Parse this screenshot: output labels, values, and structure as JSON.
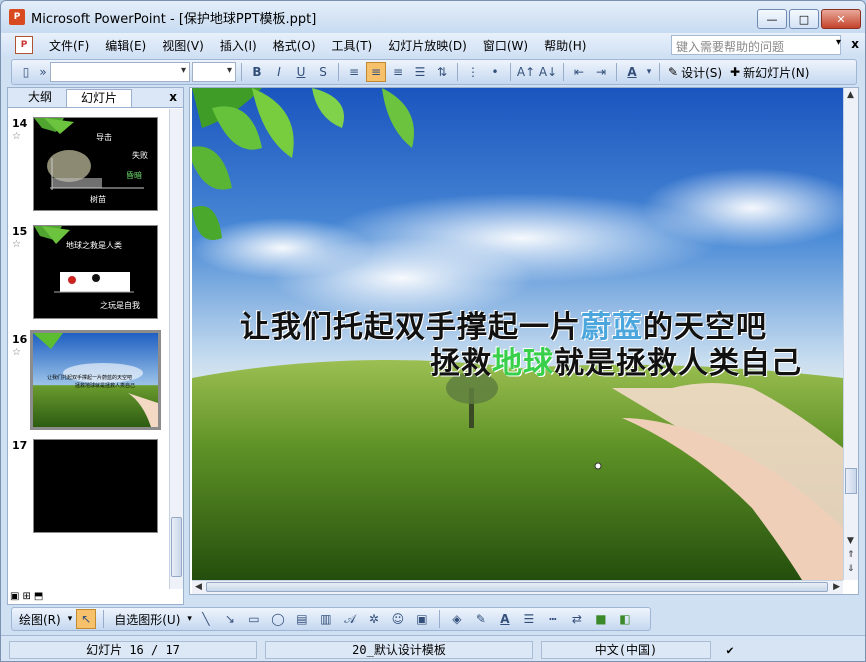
{
  "window": {
    "title": "Microsoft PowerPoint - [保护地球PPT模板.ppt]",
    "app_icon_letters": "P",
    "minimize": "—",
    "maximize": "□",
    "close": "✕"
  },
  "menu": {
    "items": [
      "文件(F)",
      "编辑(E)",
      "视图(V)",
      "插入(I)",
      "格式(O)",
      "工具(T)",
      "幻灯片放映(D)",
      "窗口(W)",
      "帮助(H)"
    ],
    "help_placeholder": "键入需要帮助的问题",
    "help_arrow": "▾",
    "close": "x"
  },
  "toolbar": {
    "design_label": "设计(S)",
    "new_slide_label": "新幻灯片(N)"
  },
  "pane": {
    "tab_outline": "大纲",
    "tab_slides": "幻灯片",
    "close": "x",
    "thumbs": [
      {
        "num": "14",
        "lines": [
          "导击",
          "失败",
          "昏暗",
          "树苗"
        ]
      },
      {
        "num": "15",
        "lines": [
          "地球之救是人类",
          "之玩是自我"
        ]
      },
      {
        "num": "16",
        "lines": [
          "让我们托起双手撑起一片蔚蓝的天空吧",
          "拯救地球就是拯救人类自己"
        ]
      },
      {
        "num": "17",
        "lines": []
      }
    ]
  },
  "slide": {
    "line1_a": "让我们托起双手撑起一片",
    "line1_b": "蔚蓝",
    "line1_c": "的天空吧",
    "line2_a": "拯救",
    "line2_b": "地球",
    "line2_c": "就是拯救人类自己"
  },
  "drawbar": {
    "draw_label": "绘图(R)",
    "autoshape_label": "自选图形(U)"
  },
  "status": {
    "slide_position": "幻灯片 16 / 17",
    "template": "20_默认设计模板",
    "language": "中文(中国)"
  },
  "colors": {
    "blue_text": "#4aa6dc",
    "green_text": "#38d04a",
    "active_button": "#f7c16b"
  }
}
